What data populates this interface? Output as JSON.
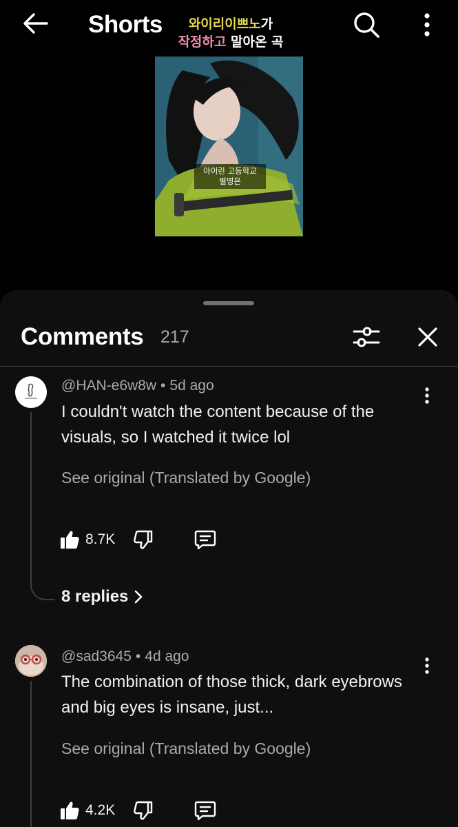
{
  "topbar": {
    "title": "Shorts"
  },
  "video": {
    "caption_line1_a": "와이리이쁘노",
    "caption_line1_b": "가",
    "caption_line2_a": "작정하고",
    "caption_line2_b": " 말아온 곡",
    "subtitle_line1": "아이린 고등학교",
    "subtitle_line2": "별명은"
  },
  "comments_sheet": {
    "title": "Comments",
    "count": "217"
  },
  "comments": [
    {
      "author": "@HAN-e6w8w",
      "separator": "•",
      "age": "5d ago",
      "text": "I couldn't watch the content because of the visuals, so I watched it twice lol",
      "translation_link": "See original (Translated by Google)",
      "likes": "8.7K",
      "replies_label": "8 replies"
    },
    {
      "author": "@sad3645",
      "separator": "•",
      "age": "4d ago",
      "text": "The combination of those thick, dark eyebrows and big eyes is insane, just...",
      "translation_link": "See original (Translated by Google)",
      "likes": "4.2K"
    }
  ],
  "colors": {
    "background": "#000000",
    "sheet": "#0f0f0f",
    "text_primary": "#f1f1f1",
    "text_secondary": "#aaaaaa",
    "caption_yellow": "#e6d84a",
    "caption_pink": "#f28ab0"
  },
  "icons": [
    "arrow-left-icon",
    "search-icon",
    "more-vert-icon",
    "filter-icon",
    "close-icon",
    "thumb-up-icon",
    "thumb-down-icon",
    "comment-reply-icon",
    "chevron-right-icon"
  ]
}
